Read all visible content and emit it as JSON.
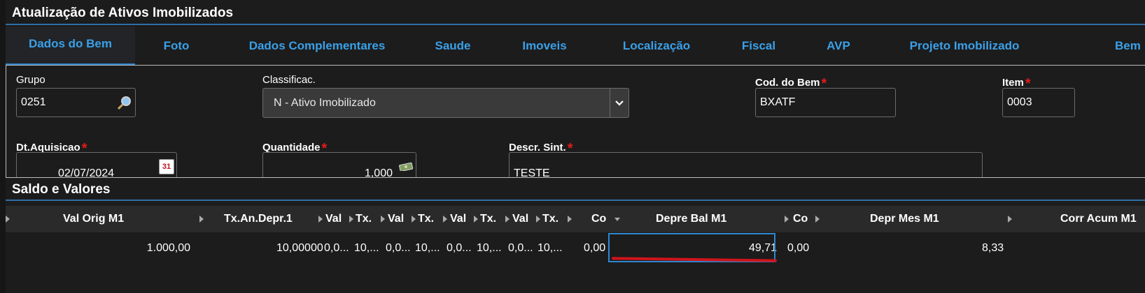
{
  "asset_section": {
    "title": "Atualização de Ativos Imobilizados"
  },
  "tabs": [
    {
      "label": "Dados do Bem"
    },
    {
      "label": "Foto"
    },
    {
      "label": "Dados Complementares"
    },
    {
      "label": "Saude"
    },
    {
      "label": "Imoveis"
    },
    {
      "label": "Localização"
    },
    {
      "label": "Fiscal"
    },
    {
      "label": "AVP"
    },
    {
      "label": "Projeto Imobilizado"
    },
    {
      "label": "Bem"
    }
  ],
  "form": {
    "grupo": {
      "label": "Grupo",
      "value": "0251"
    },
    "classificac": {
      "label": "Classificac.",
      "value": "N - Ativo Imobilizado"
    },
    "cod_bem": {
      "label": "Cod. do Bem",
      "required": "*",
      "value": "BXATF"
    },
    "item": {
      "label": "Item",
      "required": "*",
      "value": "0003"
    },
    "dt_aquisicao": {
      "label": "Dt.Aquisicao",
      "required": "*",
      "value": "02/07/2024",
      "calendar_glyph": "31"
    },
    "quantidade": {
      "label": "Quantidade",
      "required": "*",
      "value": "1,000"
    },
    "descr_sint": {
      "label": "Descr. Sint.",
      "required": "*",
      "value": "TESTE"
    }
  },
  "balances_section": {
    "title": "Saldo e Valores"
  },
  "grid": {
    "columns": [
      "Val Orig M1",
      "Tx.An.Depr.1",
      "Val",
      "Tx.",
      "Val",
      "Tx.",
      "Val",
      "Tx.",
      "Val",
      "Tx.",
      "Co",
      "Depre Bal M1",
      "Co",
      "Depr Mes M1",
      "Corr Acum M1"
    ],
    "row": [
      "1.000,00",
      "10,00000",
      "0,0...",
      "10,...",
      "0,0...",
      "10,...",
      "0,0...",
      "10,...",
      "0,0...",
      "10,...",
      "0,00",
      "49,71",
      "0,00",
      "8,33",
      ""
    ]
  },
  "colors": {
    "accent": "#2f86d1",
    "tab_text": "#3aa0e8",
    "required": "#e21b1b",
    "highlight_mark": "#d0141b"
  },
  "icons": [
    "search-icon",
    "chevron-down-icon",
    "calendar-icon",
    "money-icon",
    "sort-arrow-icon"
  ]
}
